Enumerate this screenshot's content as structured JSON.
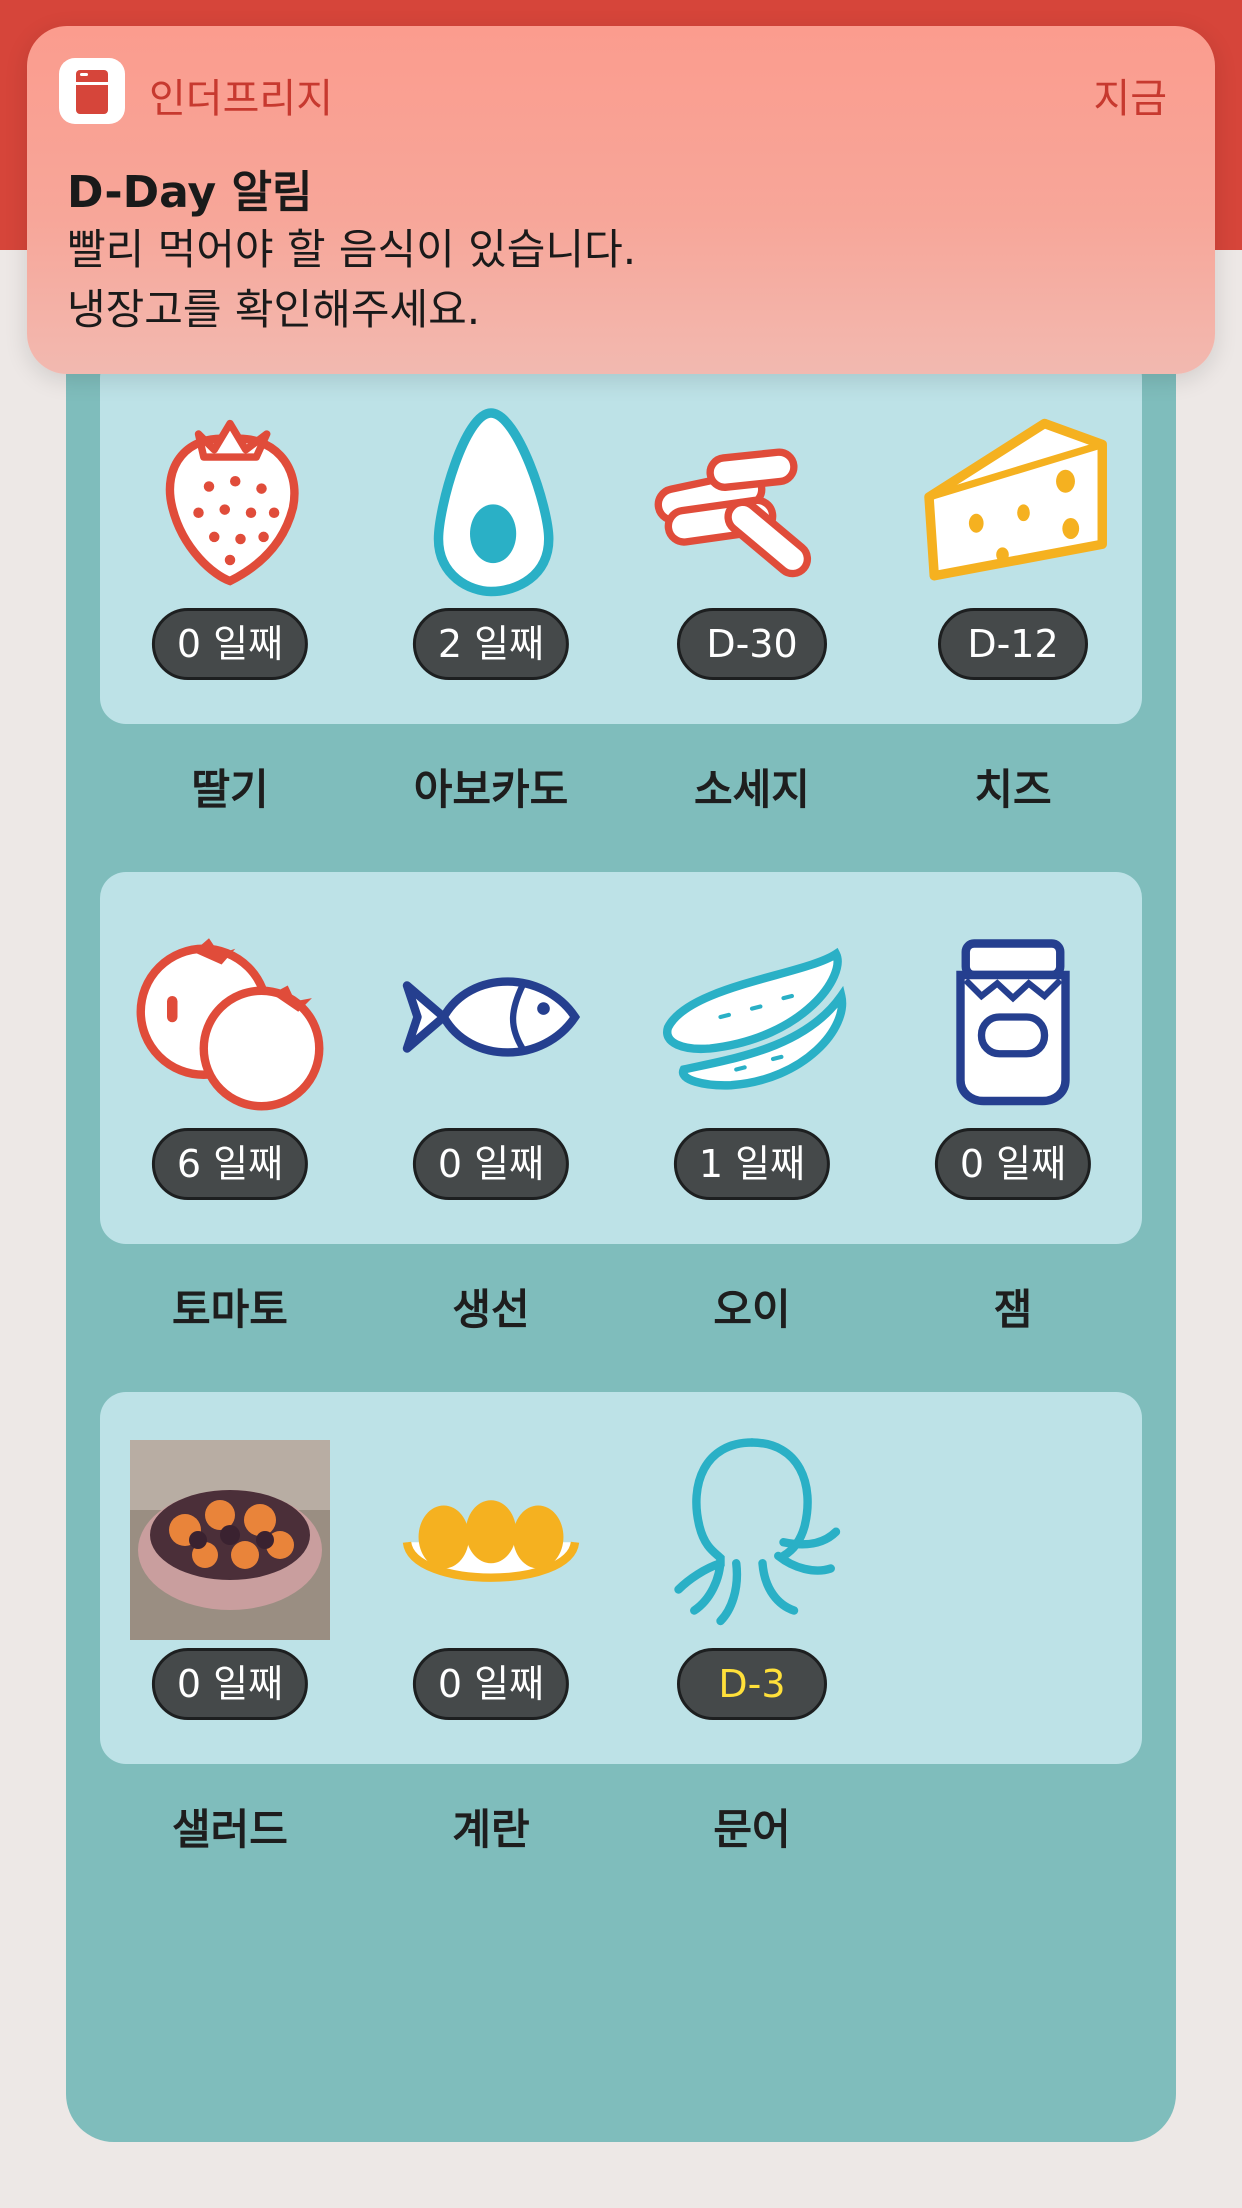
{
  "notification": {
    "app_name": "인더프리지",
    "time": "지금",
    "title": "D-Day 알림",
    "line1": "빨리 먹어야 할 음식이 있습니다.",
    "line2": "냉장고를 확인해주세요."
  },
  "foods": [
    {
      "name": "딸기",
      "badge": "0 일째",
      "icon": "strawberry-icon"
    },
    {
      "name": "아보카도",
      "badge": "2 일째",
      "icon": "avocado-icon"
    },
    {
      "name": "소세지",
      "badge": "D-30",
      "icon": "sausage-icon"
    },
    {
      "name": "치즈",
      "badge": "D-12",
      "icon": "cheese-icon"
    },
    {
      "name": "토마토",
      "badge": "6 일째",
      "icon": "tomato-icon"
    },
    {
      "name": "생선",
      "badge": "0 일째",
      "icon": "fish-icon"
    },
    {
      "name": "오이",
      "badge": "1 일째",
      "icon": "cucumber-icon"
    },
    {
      "name": "잼",
      "badge": "0 일째",
      "icon": "jam-jar-icon"
    },
    {
      "name": "샐러드",
      "badge": "0 일째",
      "icon": "salad-photo"
    },
    {
      "name": "계란",
      "badge": "0 일째",
      "icon": "eggs-icon"
    },
    {
      "name": "문어",
      "badge": "D-3",
      "icon": "octopus-icon",
      "badge_color": "#ffe03a"
    }
  ],
  "colors": {
    "header": "#d6453a",
    "panel": "#7fbdbc",
    "shelf": "#bde2e7",
    "badge": "#45494a",
    "warning_text": "#ffe03a"
  }
}
